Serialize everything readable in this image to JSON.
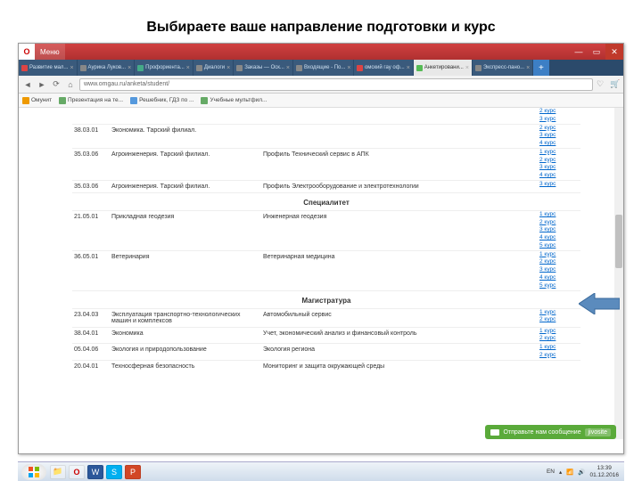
{
  "slide_title": "Выбираете ваше направление подготовки и курс",
  "browser": {
    "menu_label": "Меню",
    "url": "www.omgau.ru/anketa/student/",
    "win_min": "—",
    "win_max": "▭",
    "win_close": "✕",
    "newtab": "+",
    "back": "◄",
    "fwd": "►",
    "reload": "⟳",
    "home": "⌂",
    "heart": "♡",
    "cart": "🛒"
  },
  "tabs": [
    {
      "label": "Развитие мал..."
    },
    {
      "label": "Аурика Луков..."
    },
    {
      "label": "Профориента..."
    },
    {
      "label": "Диалоги"
    },
    {
      "label": "Заказы — Оск..."
    },
    {
      "label": "Входящие - По..."
    },
    {
      "label": "омский гау оф..."
    },
    {
      "label": "Анкетировани..."
    },
    {
      "label": "Экспресс-пано..."
    }
  ],
  "bookmarks": [
    {
      "label": "Омунит"
    },
    {
      "label": "Презентация на те..."
    },
    {
      "label": "Решебник, ГДЗ по ..."
    },
    {
      "label": "Учебные мультфил..."
    }
  ],
  "content": {
    "pre_rows": [
      {
        "code": "",
        "name": "",
        "prof": "",
        "kurs": [
          "2 курс",
          "3 курс"
        ]
      },
      {
        "code": "38.03.01",
        "name": "Экономика. Тарский филиал.",
        "prof": "",
        "kurs": [
          "2 курс",
          "3 курс",
          "4 курс"
        ]
      },
      {
        "code": "35.03.06",
        "name": "Агроинженерия. Тарский филиал.",
        "prof": "Профиль Технический сервис в АПК",
        "kurs": [
          "1 курс",
          "2 курс",
          "3 курс",
          "4 курс"
        ]
      },
      {
        "code": "35.03.06",
        "name": "Агроинженерия. Тарский филиал.",
        "prof": "Профиль Электрооборудование и электротехнологии",
        "kurs": [
          "3 курс"
        ]
      }
    ],
    "sec1_title": "Специалитет",
    "sec1_rows": [
      {
        "code": "21.05.01",
        "name": "Прикладная геодезия",
        "prof": "Инженерная геодезия",
        "kurs": [
          "1 курс",
          "2 курс",
          "3 курс",
          "4 курс",
          "5 курс"
        ]
      },
      {
        "code": "36.05.01",
        "name": "Ветеринария",
        "prof": "Ветеринарная медицина",
        "kurs": [
          "1 курс",
          "2 курс",
          "3 курс",
          "4 курс",
          "5 курс"
        ]
      }
    ],
    "sec2_title": "Магистратура",
    "sec2_rows": [
      {
        "code": "23.04.03",
        "name": "Эксплуатация транспортно-технологических машин и комплексов",
        "prof": "Автомобильный сервис",
        "kurs": [
          "1 курс",
          "2 курс"
        ]
      },
      {
        "code": "38.04.01",
        "name": "Экономика",
        "prof": "Учет, экономический анализ и финансовый контроль",
        "kurs": [
          "1 курс",
          "2 курс"
        ]
      },
      {
        "code": "05.04.06",
        "name": "Экология и природопользование",
        "prof": "Экология региона",
        "kurs": [
          "1 курс",
          "2 курс"
        ]
      },
      {
        "code": "20.04.01",
        "name": "Техносферная безопасность",
        "prof": "Мониторинг и защита окружающей среды",
        "kurs": []
      }
    ]
  },
  "jivo": {
    "msg": "Отправьте нам сообщение",
    "brand": "jivosite"
  },
  "tray": {
    "lang": "EN",
    "time": "13:39",
    "date": "01.12.2016"
  }
}
